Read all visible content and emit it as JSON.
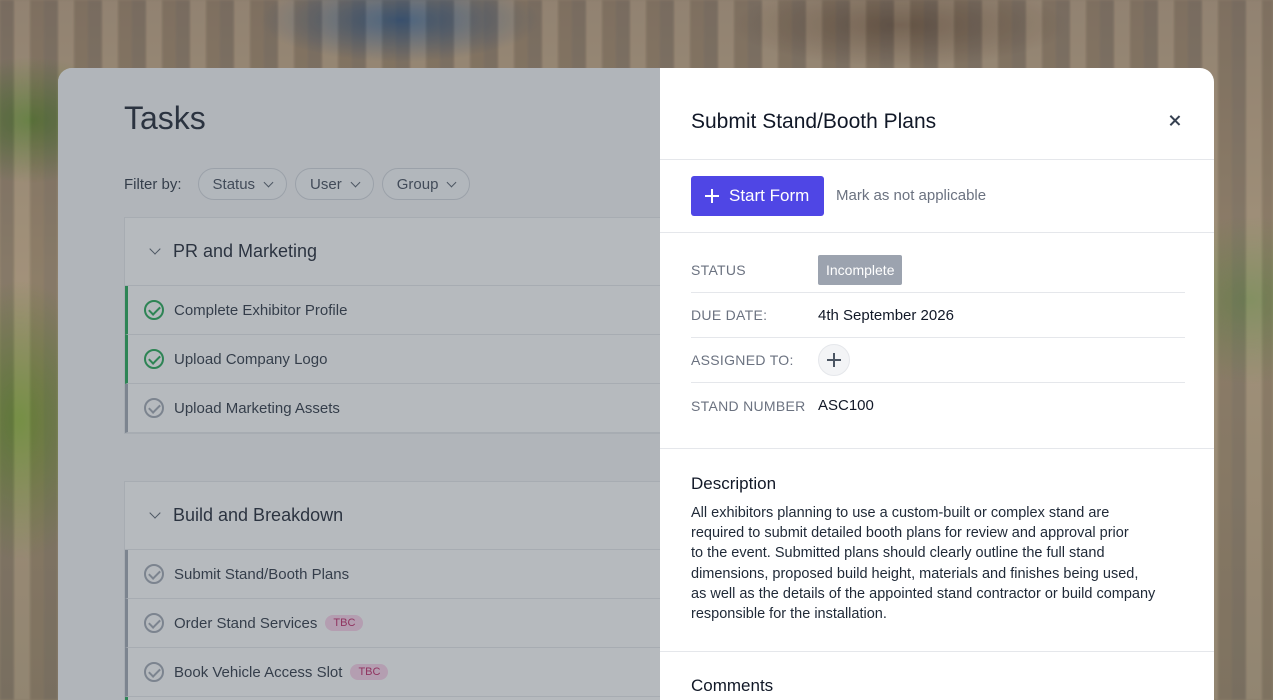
{
  "tasks": {
    "title": "Tasks",
    "filter_label": "Filter by:",
    "filters": [
      "Status",
      "User",
      "Group"
    ],
    "groups": [
      {
        "title": "PR and Marketing",
        "items": [
          {
            "label": "Complete Exhibitor Profile",
            "done": true,
            "tag": ""
          },
          {
            "label": "Upload Company Logo",
            "done": true,
            "tag": ""
          },
          {
            "label": "Upload Marketing Assets",
            "done": false,
            "tag": ""
          }
        ]
      },
      {
        "title": "Build and Breakdown",
        "items": [
          {
            "label": "Submit Stand/Booth Plans",
            "done": false,
            "tag": ""
          },
          {
            "label": "Order Stand Services",
            "done": false,
            "tag": "TBC"
          },
          {
            "label": "Book Vehicle Access Slot",
            "done": false,
            "tag": "TBC"
          }
        ]
      }
    ]
  },
  "drawer": {
    "title": "Submit Stand/Booth Plans",
    "start_form_label": "Start Form",
    "not_applicable_label": "Mark as not applicable",
    "details": {
      "status_label": "STATUS",
      "status_value": "Incomplete",
      "due_label": "DUE DATE:",
      "due_value": "4th September 2026",
      "assigned_label": "ASSIGNED TO:",
      "stand_label": "STAND NUMBER",
      "stand_value": "ASC100"
    },
    "description_title": "Description",
    "description_lines": [
      "All exhibitors planning to use a custom-built or complex stand are",
      "required to submit detailed booth plans for review and approval prior",
      "to the event. Submitted plans should clearly outline the full stand",
      "dimensions, proposed build height, materials and finishes being used,",
      "as well as the details of the appointed stand contractor or build company",
      "responsible for the installation."
    ],
    "comments_title": "Comments"
  },
  "colors": {
    "accent": "#4f46e5",
    "done": "#16a34a",
    "tbc_bg": "#fbcfe8",
    "tbc_text": "#be185d"
  }
}
